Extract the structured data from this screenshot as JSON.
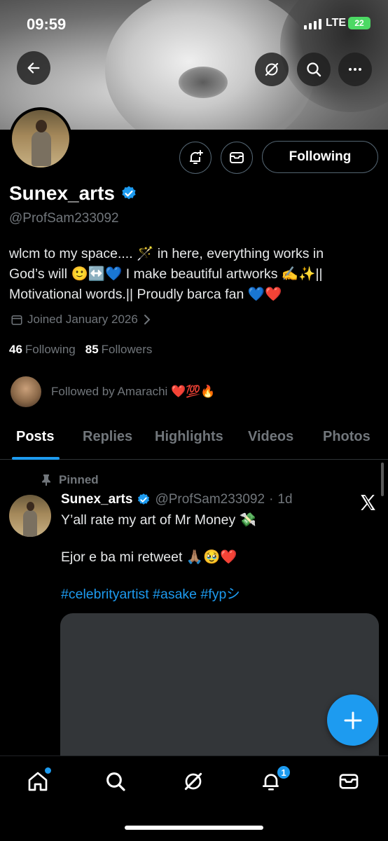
{
  "status_bar": {
    "time": "09:59",
    "network": "LTE",
    "battery": "22"
  },
  "profile": {
    "name": "Sunex_arts",
    "handle": "@ProfSam233092",
    "bio_line1": "wlcm to my space.... 🪄 in here, everything works in",
    "bio_line2": "God’s will 🙂↔️💙 I make beautiful artworks ✍️✨||",
    "bio_line3": "Motivational words.|| Proudly barca fan 💙❤️",
    "joined": "Joined January 2026",
    "following_count": "46",
    "following_label": "Following",
    "followers_count": "85",
    "followers_label": "Followers",
    "followed_by": "Followed by Amarachi ❤️💯🔥"
  },
  "actions": {
    "following_button": "Following"
  },
  "tabs": [
    {
      "label": "Posts"
    },
    {
      "label": "Replies"
    },
    {
      "label": "Highlights"
    },
    {
      "label": "Videos"
    },
    {
      "label": "Photos"
    }
  ],
  "post": {
    "pinned_label": "Pinned",
    "author_name": "Sunex_arts",
    "author_handle": "@ProfSam233092",
    "time_sep": "·",
    "time": "1d",
    "line1": "Y’all rate my art of Mr Money 💸",
    "line2": "Ejor e ba mi retweet 🙏🏽🥹❤️",
    "tags": "#celebrityartist #asake #fypシ"
  },
  "nav": {
    "notifications_badge": "1"
  },
  "colors": {
    "accent": "#1d9bf0",
    "background": "#000000",
    "muted": "#71767b"
  }
}
